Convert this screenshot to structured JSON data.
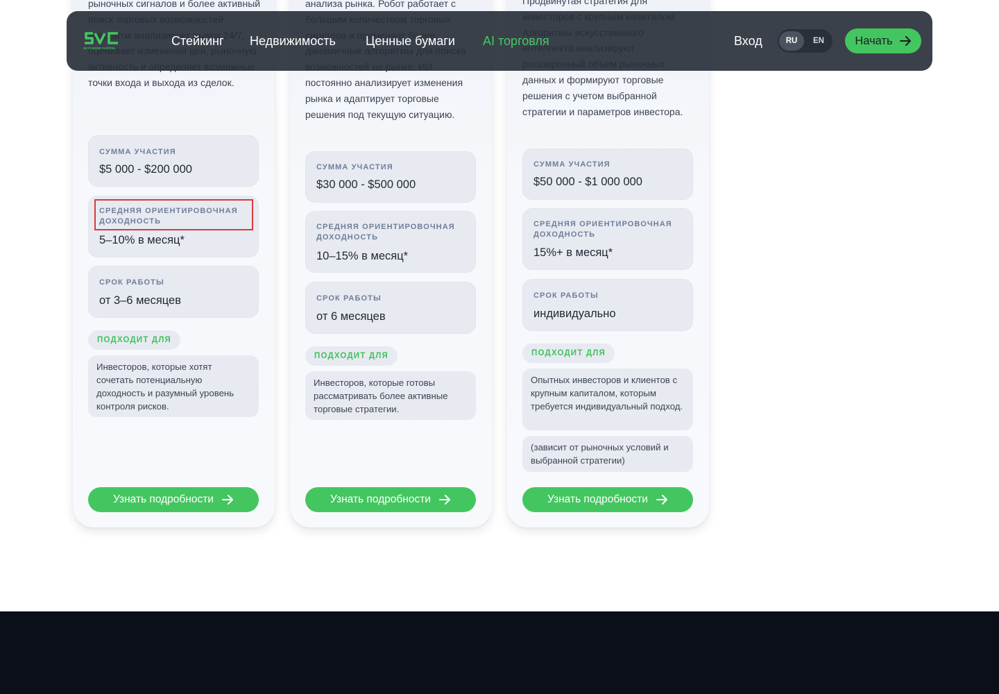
{
  "nav": {
    "logo_text": "SVC",
    "logo_subtext": "SKYVISION CAPITAL",
    "links": [
      "Стейкинг",
      "Недвижимость",
      "Ценные бумаги",
      "AI торговля"
    ],
    "active_link": "AI торговля",
    "login": "Вход",
    "lang": [
      "RU",
      "EN"
    ],
    "lang_selected": "RU",
    "start": "Начать"
  },
  "cards": [
    {
      "desc": "рыночных сигналов и более активный поиск торговых возможностей. Алгоритм анализирует рынок 24/7, оценивает изменения цен, рыночную активность и определяет возможные точки входа и выхода из сделок.",
      "amount_label": "Сумма участия",
      "amount": "$5 000 - $200 000",
      "yield_label": "Средняя ориентировочная доходность",
      "yield": "5–10% в месяц*",
      "term_label": "Срок работы",
      "term": "от 3–6 месяцев",
      "fits_label": "Подходит для",
      "fits": "Инвесторов, которые хотят сочетать потенциальную доходность и разумный уровень контроля рисков.",
      "button": "Узнать подробности"
    },
    {
      "desc": "анализа рынка. Робот работает с большим количеством торговых сигналов и применяет более динамичные алгоритмы для поиска возможностей на рынке. ИИ постоянно анализирует изменения рынка и адаптирует торговые решения под текущую ситуацию.",
      "amount_label": "Сумма участия",
      "amount": "$30 000 - $500 000",
      "yield_label": "Средняя ориентировочная доходность",
      "yield": "10–15% в месяц*",
      "term_label": "Срок работы",
      "term": "от 6 месяцев",
      "fits_label": "Подходит для",
      "fits": "Инвесторов, которые готовы рассматривать более активные торговые стратегии.",
      "button": "Узнать подробности"
    },
    {
      "desc": "Продвинутая стратегия для инвесторов с крупным капиталом. Алгоритмы искусственного интеллекта анализируют расширенный объем рыночных данных и формируют торговые решения с учетом выбранной стратегии и параметров инвестора.",
      "amount_label": "Сумма участия",
      "amount": "$50 000 - $1 000 000",
      "yield_label": "Средняя ориентировочная доходность",
      "yield": "15%+ в месяц*",
      "term_label": "Срок работы",
      "term": "индивидуально",
      "fits_label": "Подходит для",
      "fits": "Опытных инвесторов и клиентов с крупным капиталом, которым требуется индивидуальный подход.",
      "note": "(зависит от рыночных условий и выбранной стратегии)",
      "button": "Узнать подробности"
    }
  ],
  "colors": {
    "accent": "#43c65f",
    "nav_bg": "#262c36",
    "footer_bg": "#0b0f17",
    "highlight": "#d93a3a"
  }
}
